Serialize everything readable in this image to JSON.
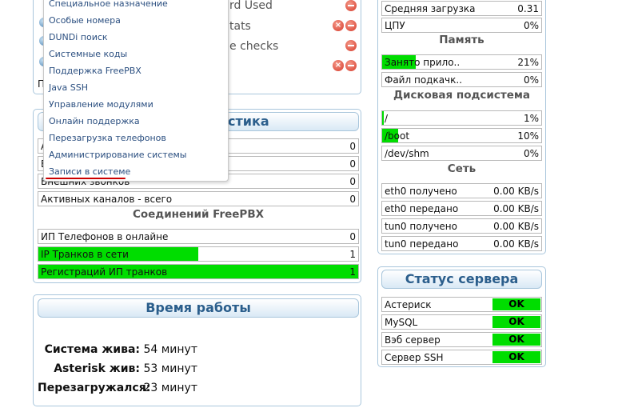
{
  "background_panel": {
    "items": [
      "rd Used",
      "tats",
      "e checks"
    ],
    "footer_char": "П"
  },
  "menu": {
    "items": [
      "Специальное назначение",
      "Особые номера",
      "DUNDi поиск",
      "Системные коды",
      "Поддержка FreePBX",
      "Java SSH",
      "Управление модулями",
      "Онлайн поддержка",
      "Перезагрузка телефонов",
      "Администрирование системы",
      "Записи в системе"
    ]
  },
  "stats": {
    "title_visible": "стика",
    "rows": [
      {
        "label": "А",
        "value": "0"
      },
      {
        "label": "В",
        "value": "0"
      },
      {
        "label": "Внешних звонков",
        "value": "0"
      },
      {
        "label": "Активных каналов - всего",
        "value": "0"
      }
    ],
    "connections_title": "Соединений FreePBX",
    "connection_rows": [
      {
        "label": "ИП Телефонов в онлайне",
        "value": "0",
        "fill": 0
      },
      {
        "label": "IP Транков в сети",
        "value": "1",
        "fill": 0.5
      },
      {
        "label": "Регистраций ИП транков",
        "value": "1",
        "fill": 1.0
      }
    ]
  },
  "uptime": {
    "title": "Время работы",
    "rows": [
      {
        "label": "Система жива:",
        "value": "54 минут"
      },
      {
        "label": "Asterisk жив:",
        "value": "53 минут"
      },
      {
        "label": "Перезагружался:",
        "value": "23 минут"
      }
    ]
  },
  "system": {
    "cpu_rows": [
      {
        "label": "Средняя загрузка",
        "value": "0.31",
        "fill": 0
      },
      {
        "label": "ЦПУ",
        "value": "0%",
        "fill": 0
      }
    ],
    "memory_title": "Память",
    "memory_rows": [
      {
        "label": "Занято прило..",
        "value": "21%",
        "fill": 0.21
      },
      {
        "label": "Файл подкачк..",
        "value": "0%",
        "fill": 0
      }
    ],
    "disk_title": "Дисковая подсистема",
    "disk_rows": [
      {
        "label": "/",
        "value": "1%",
        "fill": 0.01
      },
      {
        "label": "/boot",
        "value": "10%",
        "fill": 0.1
      },
      {
        "label": "/dev/shm",
        "value": "0%",
        "fill": 0
      }
    ],
    "network_title": "Сеть",
    "network_rows": [
      {
        "label": "eth0 получено",
        "value": "0.00 KB/s"
      },
      {
        "label": "eth0 передано",
        "value": "0.00 KB/s"
      },
      {
        "label": "tun0 получено",
        "value": "0.00 KB/s"
      },
      {
        "label": "tun0 передано",
        "value": "0.00 KB/s"
      }
    ]
  },
  "server_status": {
    "title": "Статус сервера",
    "rows": [
      {
        "label": "Астериск",
        "status": "OK"
      },
      {
        "label": "MySQL",
        "status": "OK"
      },
      {
        "label": "Вэб сервер",
        "status": "OK"
      },
      {
        "label": "Сервер SSH",
        "status": "OK"
      }
    ]
  },
  "colors": {
    "ok": "#00dd00",
    "accent": "#2b5e8c"
  }
}
